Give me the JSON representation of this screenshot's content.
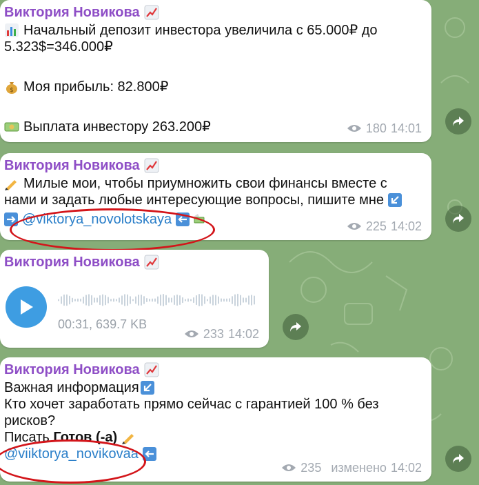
{
  "messages": [
    {
      "sender": "Виктория Новикова",
      "lines": [
        "Начальный депозит инвестора увеличила с 65.000₽ до",
        "5.323$=346.000₽",
        "Моя прибыль: 82.800₽",
        "Выплата инвестору 263.200₽"
      ],
      "views": "180",
      "time": "14:01"
    },
    {
      "sender": "Виктория Новикова",
      "lines": [
        "Милые мои, чтобы приумножить свои финансы вместе с",
        "нами и задать любые интересующие вопросы, пишите мне"
      ],
      "mention": "@viktorya_novolotskaya",
      "views": "225",
      "time": "14:02"
    },
    {
      "sender": "Виктория Новикова",
      "voice_info": "00:31, 639.7 KB",
      "views": "233",
      "time": "14:02"
    },
    {
      "sender": "Виктория Новикова",
      "lines": [
        "Важная информация",
        "Кто хочет заработать прямо сейчас с гарантией 100 % без",
        "рисков?",
        "Писать "
      ],
      "bold_word": "Готов (-а)",
      "mention": "@viiktorya_novikovaa",
      "views": "235",
      "edited": "изменено",
      "time": "14:02"
    }
  ],
  "colors": {
    "sender": "#8e4ec6",
    "mention": "#2b7fc9",
    "highlight_ring": "#d3151a",
    "play_button": "#3e9de2"
  },
  "icons": [
    "chart-increasing-icon",
    "bar-chart-icon",
    "money-bag-icon",
    "dollar-banknote-icon",
    "writing-hand-icon",
    "arrow-down-left-icon",
    "arrow-right-icon",
    "arrow-left-icon",
    "eye-icon",
    "share-icon",
    "play-icon"
  ]
}
